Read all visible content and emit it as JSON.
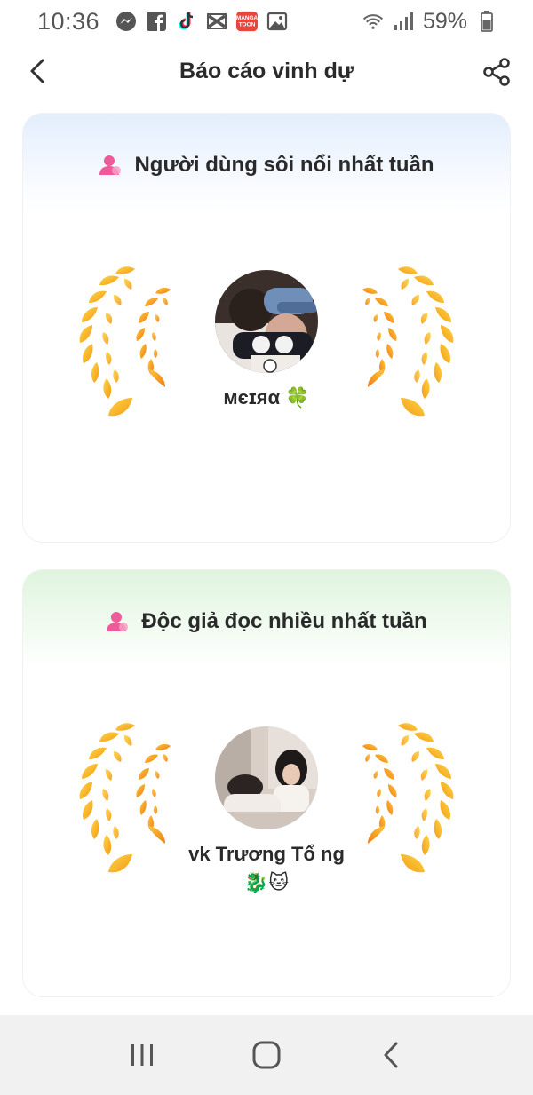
{
  "status": {
    "time": "10:36",
    "battery": "59%",
    "apps": [
      "messenger-icon",
      "facebook-icon",
      "tiktok-icon",
      "capcut-icon",
      "mangatoon-icon",
      "gallery-icon"
    ],
    "mangatoon_label": "MANGA TOON"
  },
  "header": {
    "title": "Báo cáo vinh dự"
  },
  "cards": [
    {
      "title": "Người dùng sôi nổi nhất tuần",
      "winner": "ᴍєɪяα 🍀",
      "accent": "#e3eefc"
    },
    {
      "title": "Độc giả đọc nhiều nhất tuần",
      "winner": "vk Trương Tổ ng🐉🐱",
      "accent": "#dff4de"
    }
  ],
  "colors": {
    "laurel_gold": "#f5b81c",
    "laurel_orange": "#f08a1a",
    "user_icon_pink": "#ef5a9b"
  }
}
